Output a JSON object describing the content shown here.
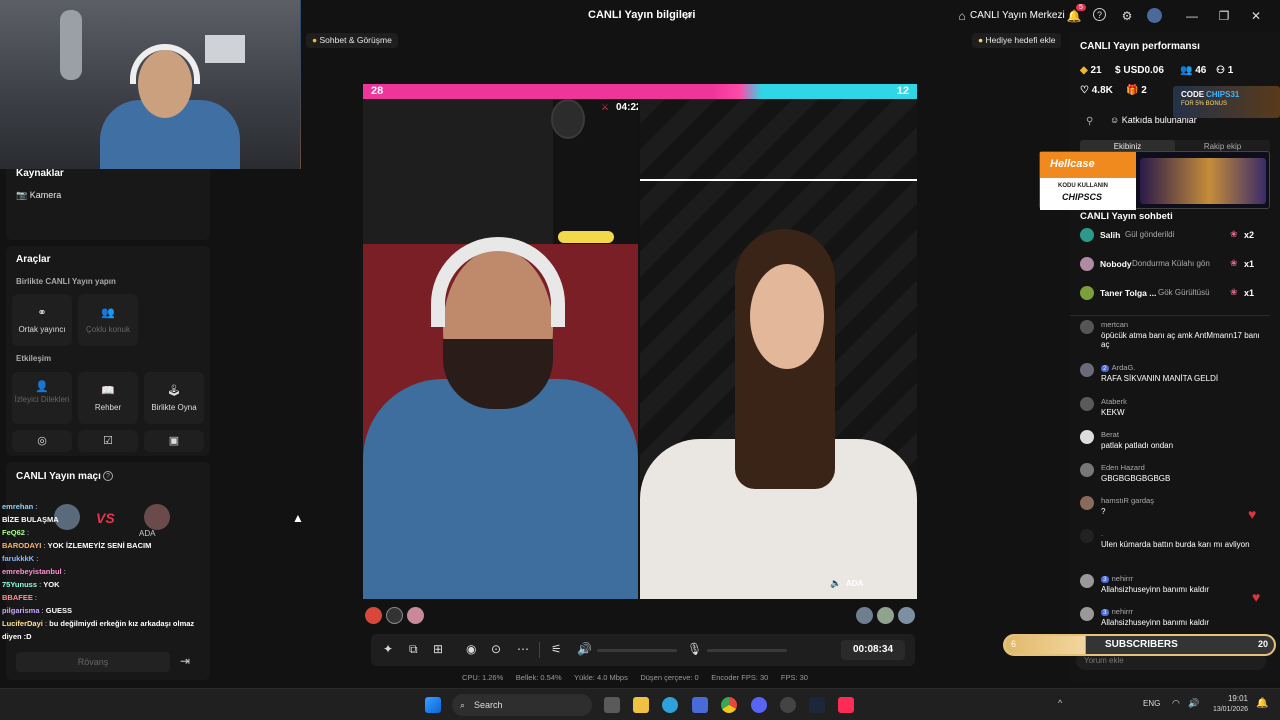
{
  "window": {
    "title": "CANLI Yayın bilgileri",
    "live_center": "CANLI Yayın Merkezi",
    "notif_count": "5"
  },
  "overlay_tags": {
    "chat_call": "Sohbet & Görüşme",
    "gift_goal": "Hediye hedefi ekle"
  },
  "left": {
    "sources_title": "Kaynaklar",
    "camera": "Kamera",
    "tools_title": "Araçlar",
    "collab_title": "Birlikte CANLI Yayın yapın",
    "cohost": "Ortak yayıncı",
    "multi_guest": "Çoklu konuk",
    "interaction_title": "Etkileşim",
    "viewer_requests": "İzleyici Dilekleri",
    "guide": "Rehber",
    "play_together": "Birlikte Oyna",
    "match_title": "CANLI Yayın maçı",
    "rematch": "Rövanş",
    "match_vs": "VS",
    "match_opponent": "ADA"
  },
  "left_chat": [
    {
      "user": "emrehan",
      "msg": ""
    },
    {
      "user": "",
      "msg": "BİZE BULAŞMA"
    },
    {
      "user": "FeQ62",
      "msg": ""
    },
    {
      "user": "BARODAYI",
      "msg": "YOK İZLEMEYİZ SENİ BACIM"
    },
    {
      "user": "farukkkK",
      "msg": ""
    },
    {
      "user": "emrebeyistanbul",
      "msg": ""
    },
    {
      "user": "75Yunuss",
      "msg": "YOK"
    },
    {
      "user": "BBAFEE",
      "msg": ""
    },
    {
      "user": "pilgarisma",
      "msg": "GUESS"
    },
    {
      "user": "LuciferDayi",
      "msg": "bu değilmiydi erkeğin kız arkadaşı olmaz diyen :D"
    }
  ],
  "battle": {
    "score_left": "28",
    "score_right": "12",
    "timer": "04:22",
    "opponent_label": "ADA"
  },
  "controls": {
    "elapsed": "00:08:34"
  },
  "stats_bar": {
    "cpu": "CPU: 1.26%",
    "memory": "Bellek: 0.54%",
    "upload": "Yükle: 4.0 Mbps",
    "dropped": "Düşen çerçeve: 0",
    "encoder": "Encoder FPS: 30",
    "fps": "FPS: 30"
  },
  "right": {
    "perf_title": "CANLI Yayın performansı",
    "diamonds": "21",
    "usd": "USD0.06",
    "viewers": "46",
    "new_followers": "1",
    "likes": "4.8K",
    "gifts": "2",
    "contributors": "Katkıda bulunanlar",
    "tab_team": "Ekibiniz",
    "tab_opponent": "Rakip ekip",
    "chat_title": "CANLI Yayın sohbeti",
    "gift_rows": [
      {
        "name": "Salih",
        "text": "Gül gönderildi",
        "count": "x2"
      },
      {
        "name": "Nobody",
        "text": "Dondurma Külahı gön",
        "count": "x1"
      },
      {
        "name": "Taner Tolga ...",
        "text": "Gök Gürültüsü",
        "count": "x1"
      }
    ],
    "chat": [
      {
        "name": "mertcan",
        "msg": "öpücük atma banı aç amk AntMmann17 banı aç"
      },
      {
        "name": "ArdaG.",
        "msg": "RAFA SİKVANIN MANİTA GELDİ",
        "level": "2"
      },
      {
        "name": "Ataberk",
        "msg": "KEKW"
      },
      {
        "name": "Berat",
        "msg": "patlak patladı ondan"
      },
      {
        "name": "Eden Hazard",
        "msg": "GBGBGBGBGBGB"
      },
      {
        "name": "hamstıR gardaş",
        "msg": "?"
      },
      {
        "name": ".",
        "msg": "Ulen kümarda battın burda karı mı avliyon"
      },
      {
        "name": "nehirrr",
        "msg": "Allahsizhuseyinn banımı kaldır",
        "level": "3"
      },
      {
        "name": "nehirrr",
        "msg": "Allahsizhuseyinn banımı kaldır",
        "level": "3"
      }
    ],
    "comment_placeholder": "Yorum ekle"
  },
  "ads": {
    "code_top": "CODE",
    "code_value": "CHIPS31",
    "bonus": "FOR 5% BONUS",
    "brand": "Hellcase",
    "use_code": "KODU KULLANIN",
    "promo_code": "CHIPSCS"
  },
  "subscribers": {
    "label": "SUBSCRIBERS",
    "current": "6",
    "goal": "20",
    "progress": 0.3
  },
  "taskbar": {
    "search": "Search",
    "lang": "ENG",
    "time": "19:01",
    "date": "13/01/2026"
  }
}
